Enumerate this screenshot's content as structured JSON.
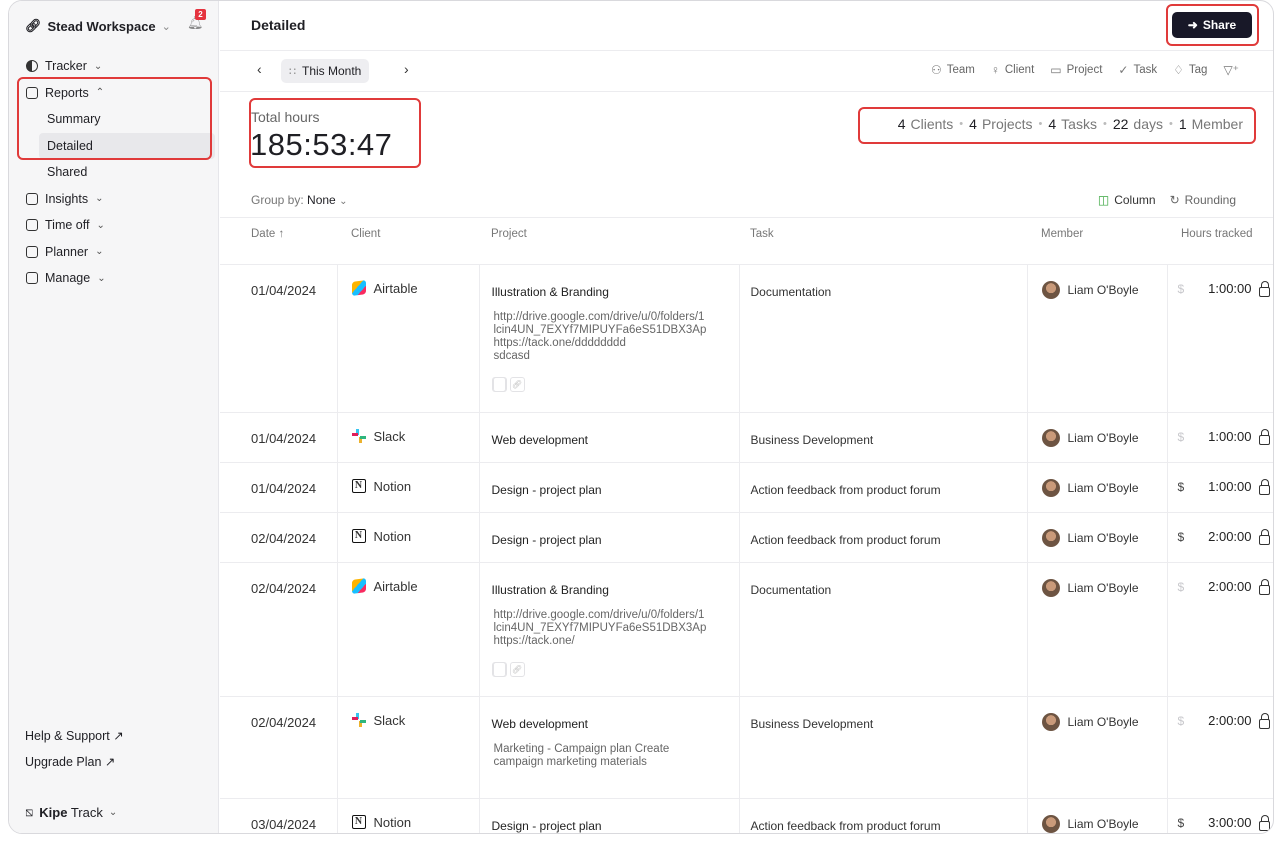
{
  "workspace": {
    "name": "Stead Workspace",
    "notifications": "2"
  },
  "sidebar": {
    "items": [
      {
        "label": "Tracker"
      },
      {
        "label": "Reports",
        "children": [
          "Summary",
          "Detailed",
          "Shared"
        ]
      },
      {
        "label": "Insights"
      },
      {
        "label": "Time off"
      },
      {
        "label": "Planner"
      },
      {
        "label": "Manage"
      }
    ],
    "help": "Help & Support ↗",
    "upgrade": "Upgrade Plan ↗",
    "brand_bold": "Kipe",
    "brand_rest": "Track"
  },
  "header": {
    "title": "Detailed",
    "share_label": "Share"
  },
  "filterbar": {
    "period": "This Month",
    "filters": [
      "Team",
      "Client",
      "Project",
      "Task",
      "Tag"
    ]
  },
  "totals": {
    "label": "Total hours",
    "value": "185:53:47",
    "clients_n": "4",
    "clients": "Clients",
    "projects_n": "4",
    "projects": "Projects",
    "tasks_n": "4",
    "tasks": "Tasks",
    "days_n": "22",
    "days": "days",
    "members_n": "1",
    "members": "Member"
  },
  "controls": {
    "group_by_label": "Group by:",
    "group_by_value": "None",
    "column": "Column",
    "rounding": "Rounding"
  },
  "table": {
    "columns": [
      "Date ↑",
      "Client",
      "Project",
      "Task",
      "Member",
      "Hours tracked"
    ],
    "rows": [
      {
        "date": "01/04/2024",
        "client": "Airtable",
        "logo": "airtable-logo",
        "project": "Illustration & Branding",
        "desc": "http://drive.google.com/drive/u/0/folders/1\nlcin4UN_7EXYf7MIPUYFa6eS51DBX3Ap\nhttps://tack.one/dddddddd\nsdcasd",
        "attach": true,
        "task": "Documentation",
        "member": "Liam O'Boyle",
        "billable": false,
        "hours": "1:00:00",
        "height": 148
      },
      {
        "date": "01/04/2024",
        "client": "Slack",
        "logo": "slack-logo",
        "project": "Web development",
        "desc": "",
        "attach": false,
        "task": "Business Development",
        "member": "Liam O'Boyle",
        "billable": false,
        "hours": "1:00:00",
        "height": 50
      },
      {
        "date": "01/04/2024",
        "client": "Notion",
        "logo": "notion-logo",
        "project": "Design - project plan",
        "desc": "",
        "attach": false,
        "task": "Action feedback from product forum",
        "member": "Liam O'Boyle",
        "billable": true,
        "hours": "1:00:00",
        "height": 50
      },
      {
        "date": "02/04/2024",
        "client": "Notion",
        "logo": "notion-logo",
        "project": "Design - project plan",
        "desc": "",
        "attach": false,
        "task": "Action feedback from product forum",
        "member": "Liam O'Boyle",
        "billable": true,
        "hours": "2:00:00",
        "height": 50
      },
      {
        "date": "02/04/2024",
        "client": "Airtable",
        "logo": "airtable-logo",
        "project": "Illustration & Branding",
        "desc": "http://drive.google.com/drive/u/0/folders/1\nlcin4UN_7EXYf7MIPUYFa6eS51DBX3Ap\nhttps://tack.one/",
        "attach": true,
        "task": "Documentation",
        "member": "Liam O'Boyle",
        "billable": false,
        "hours": "2:00:00",
        "height": 134
      },
      {
        "date": "02/04/2024",
        "client": "Slack",
        "logo": "slack-logo",
        "project": "Web development",
        "desc": "Marketing - Campaign plan Create\ncampaign marketing materials",
        "attach": false,
        "task": "Business Development",
        "member": "Liam O'Boyle",
        "billable": false,
        "hours": "2:00:00",
        "height": 102
      },
      {
        "date": "03/04/2024",
        "client": "Notion",
        "logo": "notion-logo",
        "project": "Design - project plan",
        "desc": "",
        "attach": false,
        "task": "Action feedback from product forum",
        "member": "Liam O'Boyle",
        "billable": true,
        "hours": "3:00:00",
        "height": 50
      }
    ]
  }
}
